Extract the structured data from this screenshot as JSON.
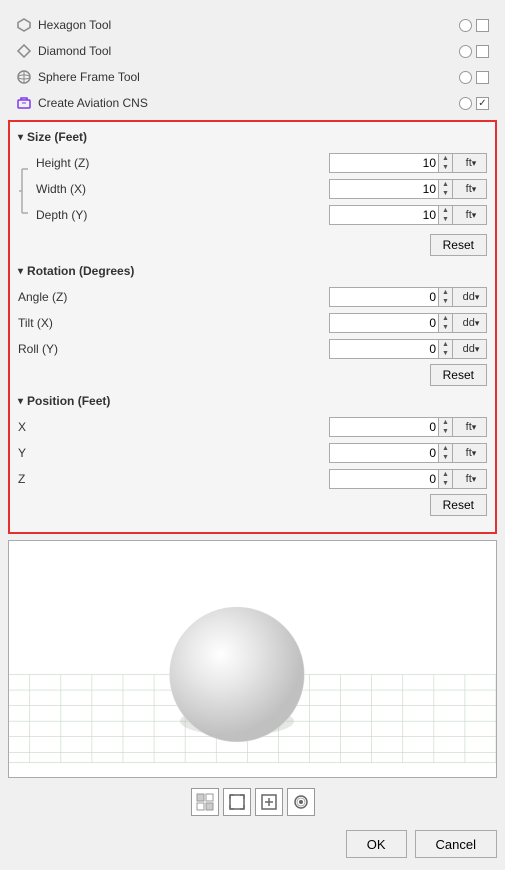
{
  "tools": [
    {
      "id": "hexagon",
      "label": "Hexagon Tool",
      "icon": "hexagon",
      "checked": false
    },
    {
      "id": "diamond",
      "label": "Diamond Tool",
      "icon": "diamond",
      "checked": false
    },
    {
      "id": "sphere-frame",
      "label": "Sphere Frame Tool",
      "icon": "sphere-frame",
      "checked": false
    },
    {
      "id": "aviation-cns",
      "label": "Create Aviation CNS",
      "icon": "aviation",
      "checked": true
    }
  ],
  "size_section": {
    "header": "Size (Feet)",
    "fields": [
      {
        "id": "height",
        "label": "Height (Z)",
        "value": "10",
        "unit": "ft"
      },
      {
        "id": "width",
        "label": "Width (X)",
        "value": "10",
        "unit": "ft"
      },
      {
        "id": "depth",
        "label": "Depth (Y)",
        "value": "10",
        "unit": "ft"
      }
    ],
    "reset_label": "Reset"
  },
  "rotation_section": {
    "header": "Rotation (Degrees)",
    "fields": [
      {
        "id": "angle",
        "label": "Angle (Z)",
        "value": "0",
        "unit": "dd"
      },
      {
        "id": "tilt",
        "label": "Tilt (X)",
        "value": "0",
        "unit": "dd"
      },
      {
        "id": "roll",
        "label": "Roll (Y)",
        "value": "0",
        "unit": "dd"
      }
    ],
    "reset_label": "Reset"
  },
  "position_section": {
    "header": "Position (Feet)",
    "fields": [
      {
        "id": "pos-x",
        "label": "X",
        "value": "0",
        "unit": "ft"
      },
      {
        "id": "pos-y",
        "label": "Y",
        "value": "0",
        "unit": "ft"
      },
      {
        "id": "pos-z",
        "label": "Z",
        "value": "0",
        "unit": "ft"
      }
    ],
    "reset_label": "Reset"
  },
  "preview_toolbar": [
    {
      "id": "grid-btn",
      "icon": "grid",
      "symbol": "⊞"
    },
    {
      "id": "fit-btn",
      "icon": "fit",
      "symbol": "⤢"
    },
    {
      "id": "expand-btn",
      "icon": "expand",
      "symbol": "⊡"
    },
    {
      "id": "sphere-btn",
      "icon": "sphere",
      "symbol": "◉"
    }
  ],
  "bottom": {
    "ok_label": "OK",
    "cancel_label": "Cancel"
  }
}
